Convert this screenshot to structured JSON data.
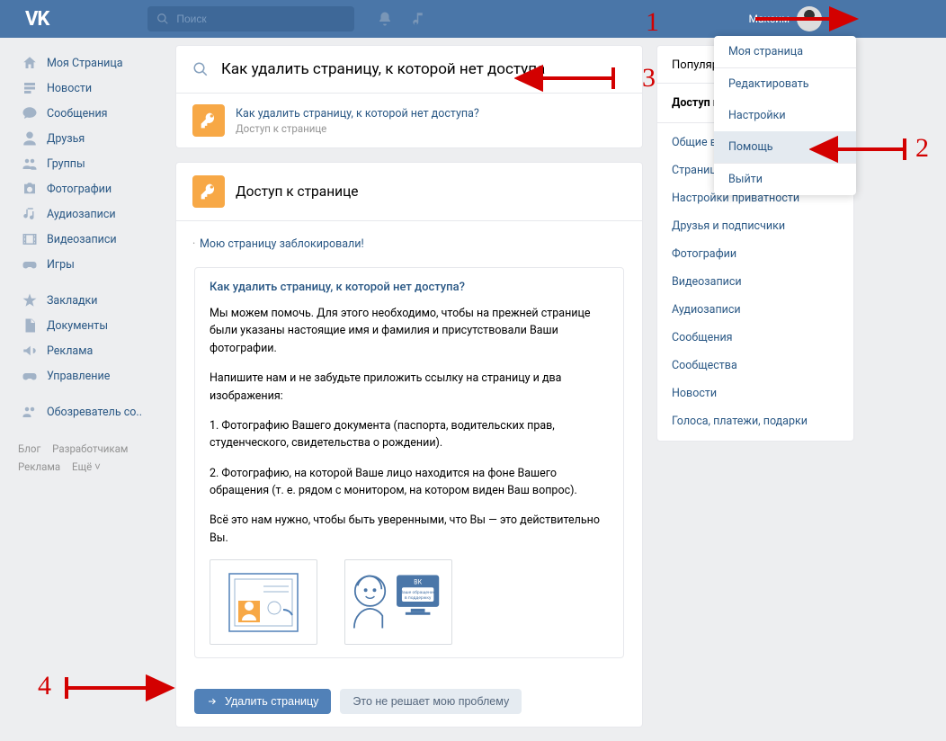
{
  "topbar": {
    "search_placeholder": "Поиск",
    "username": "Максим"
  },
  "left_nav": {
    "items": [
      {
        "label": "Моя Страница",
        "icon": "home"
      },
      {
        "label": "Новости",
        "icon": "news"
      },
      {
        "label": "Сообщения",
        "icon": "messages"
      },
      {
        "label": "Друзья",
        "icon": "friends"
      },
      {
        "label": "Группы",
        "icon": "groups"
      },
      {
        "label": "Фотографии",
        "icon": "photos"
      },
      {
        "label": "Аудиозаписи",
        "icon": "audio"
      },
      {
        "label": "Видеозаписи",
        "icon": "video"
      },
      {
        "label": "Игры",
        "icon": "games"
      }
    ],
    "items2": [
      {
        "label": "Закладки",
        "icon": "bookmark"
      },
      {
        "label": "Документы",
        "icon": "docs"
      },
      {
        "label": "Реклама",
        "icon": "ads"
      },
      {
        "label": "Управление",
        "icon": "manage"
      }
    ],
    "items3": [
      {
        "label": "Обозреватель со..",
        "icon": "community"
      }
    ],
    "footer": [
      "Блог",
      "Разработчикам",
      "Реклама",
      "Ещё ˅"
    ]
  },
  "help_search": {
    "query": "Как удалить страницу, к которой нет доступа"
  },
  "result": {
    "title": "Как удалить страницу, к которой нет доступа?",
    "subtitle": "Доступ к странице"
  },
  "section": {
    "title": "Доступ к странице",
    "first_link": "Мою страницу заблокировали!"
  },
  "qa": {
    "title": "Как удалить страницу, к которой нет доступа?",
    "p1": "Мы можем помочь. Для этого необходимо, чтобы на прежней странице были указаны настоящие имя и фамилия и присутствовали Ваши фотографии.",
    "p2": "Напишите нам и не забудьте приложить ссылку на страницу и два изображения:",
    "p3": "1. Фотографию Вашего документа (паспорта, водительских прав, студенческого, свидетельства о рождении).",
    "p4": "2. Фотографию, на которой Ваше лицо находится на фоне Вашего обращения (т. е. рядом с монитором, на котором виден Ваш вопрос).",
    "p5": "Всё это нам нужно, чтобы быть уверенными, что Вы — это действительно Вы."
  },
  "actions": {
    "primary": "Удалить страницу",
    "secondary": "Это не решает мою проблему"
  },
  "right_col": {
    "tab": "Популярные",
    "active_section": "Доступ к странице",
    "items": [
      "Общие вопросы",
      "Страница",
      "Настройки приватности",
      "Друзья и подписчики",
      "Фотографии",
      "Видеозаписи",
      "Аудиозаписи",
      "Сообщения",
      "Сообщества",
      "Новости",
      "Голоса, платежи, подарки"
    ]
  },
  "dropdown": {
    "items": [
      "Моя страница",
      "Редактировать",
      "Настройки",
      "Помощь",
      "Выйти"
    ],
    "active_index": 3
  },
  "annotations": {
    "n1": "1",
    "n2": "2",
    "n3": "3",
    "n4": "4"
  }
}
